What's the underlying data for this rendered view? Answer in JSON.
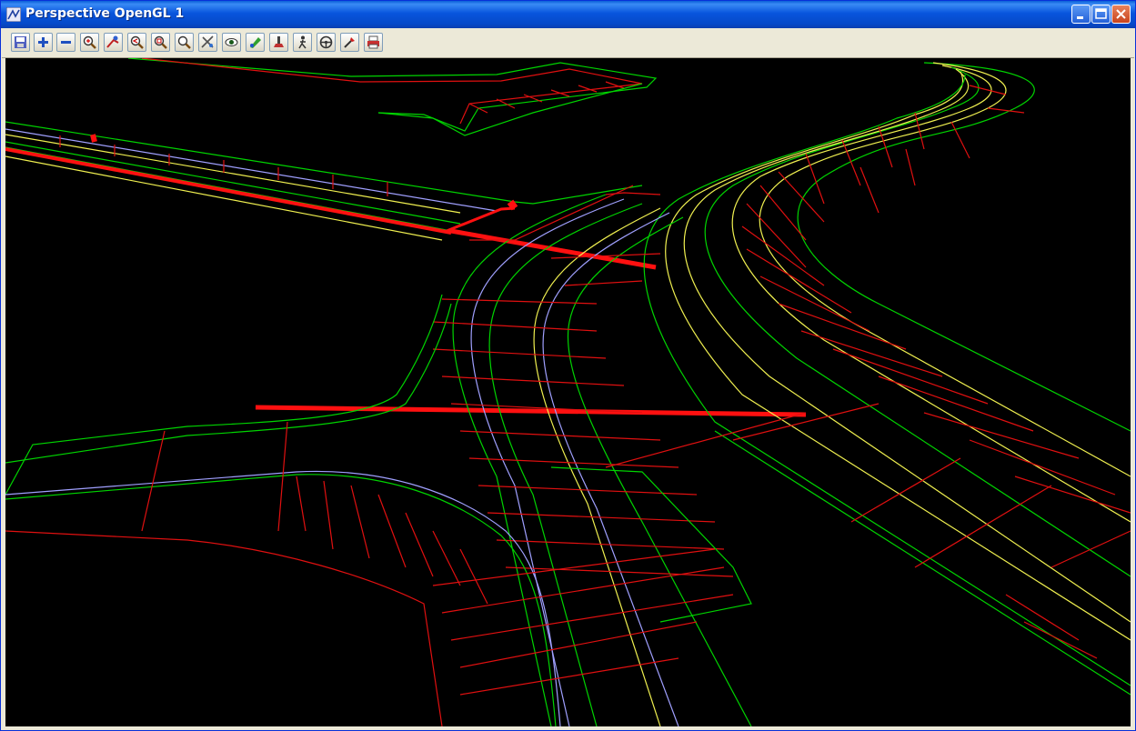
{
  "window": {
    "title": "Perspective OpenGL 1",
    "controls": [
      "minimize",
      "maximize",
      "close"
    ]
  },
  "toolbar": {
    "buttons": [
      {
        "name": "save-view-icon"
      },
      {
        "name": "zoom-in-plus-icon"
      },
      {
        "name": "zoom-out-minus-icon"
      },
      {
        "name": "zoom-in-magnifier-icon"
      },
      {
        "name": "fit-view-icon"
      },
      {
        "name": "zoom-previous-icon"
      },
      {
        "name": "zoom-window-icon"
      },
      {
        "name": "zoom-icon"
      },
      {
        "name": "pan-icon"
      },
      {
        "name": "eye-view-icon"
      },
      {
        "name": "colour-icon"
      },
      {
        "name": "light-icon"
      },
      {
        "name": "walk-icon"
      },
      {
        "name": "drive-icon"
      },
      {
        "name": "settings-icon"
      },
      {
        "name": "print-icon"
      }
    ]
  },
  "viewport": {
    "background": "#000000",
    "line_colors": {
      "edge": "#00d400",
      "section": "#e01010",
      "kerb": "#f0f050",
      "centre": "#a0a0ff",
      "highlight": "#ff1010"
    }
  }
}
